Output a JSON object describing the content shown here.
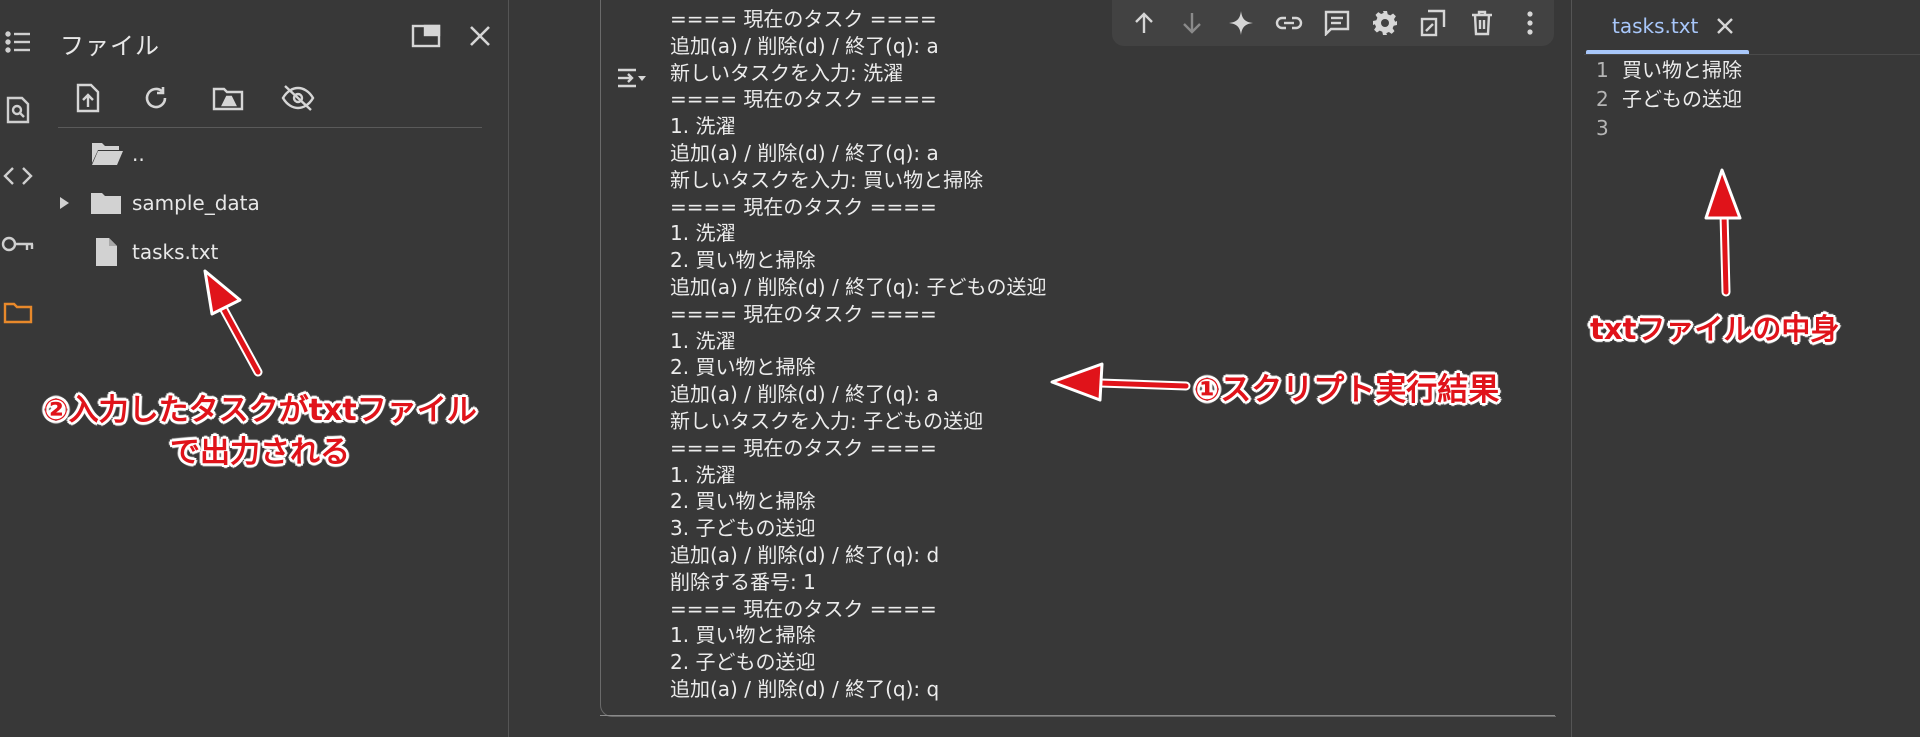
{
  "sidebar": {
    "icons": [
      "table-of-contents-icon",
      "find-replace-icon",
      "code-snippets-icon",
      "secrets-key-icon",
      "files-folder-icon"
    ]
  },
  "files_panel": {
    "title": "ファイル",
    "toolbar_icons": [
      "upload-icon",
      "refresh-icon",
      "mount-drive-icon",
      "hide-files-icon"
    ],
    "tree": [
      {
        "label": "..",
        "type": "folder-open"
      },
      {
        "label": "sample_data",
        "type": "folder"
      },
      {
        "label": "tasks.txt",
        "type": "file"
      }
    ]
  },
  "output": {
    "lines": [
      "==== 現在のタスク ====",
      "追加(a) / 削除(d) / 終了(q): a",
      "新しいタスクを入力: 洗濯",
      "==== 現在のタスク ====",
      "1. 洗濯",
      "追加(a) / 削除(d) / 終了(q): a",
      "新しいタスクを入力: 買い物と掃除",
      "==== 現在のタスク ====",
      "1. 洗濯",
      "2. 買い物と掃除",
      "追加(a) / 削除(d) / 終了(q): 子どもの送迎",
      "==== 現在のタスク ====",
      "1. 洗濯",
      "2. 買い物と掃除",
      "追加(a) / 削除(d) / 終了(q): a",
      "新しいタスクを入力: 子どもの送迎",
      "==== 現在のタスク ====",
      "1. 洗濯",
      "2. 買い物と掃除",
      "3. 子どもの送迎",
      "追加(a) / 削除(d) / 終了(q): d",
      "削除する番号: 1",
      "==== 現在のタスク ====",
      "1. 買い物と掃除",
      "2. 子どもの送迎",
      "追加(a) / 削除(d) / 終了(q): q"
    ]
  },
  "cell_toolbar": {
    "icons": [
      "move-up-icon",
      "move-down-icon",
      "gemini-sparkle-icon",
      "link-icon",
      "comment-icon",
      "settings-gear-icon",
      "mirror-cell-icon",
      "delete-trash-icon",
      "more-vert-icon"
    ]
  },
  "editor": {
    "tab_label": "tasks.txt",
    "lines": [
      {
        "num": "1",
        "text": "買い物と掃除"
      },
      {
        "num": "2",
        "text": "子どもの送迎"
      },
      {
        "num": "3",
        "text": ""
      }
    ]
  },
  "annotations": {
    "files_line1": "②入力したタスクがtxtファイル",
    "files_line2": "で出力される",
    "output": "①スクリプト実行結果",
    "editor": "txtファイルの中身"
  },
  "colors": {
    "background": "#383838",
    "accent_tab": "#a8c7fa",
    "annotation_red": "#e0131a",
    "active_folder_icon": "#e8892b"
  }
}
